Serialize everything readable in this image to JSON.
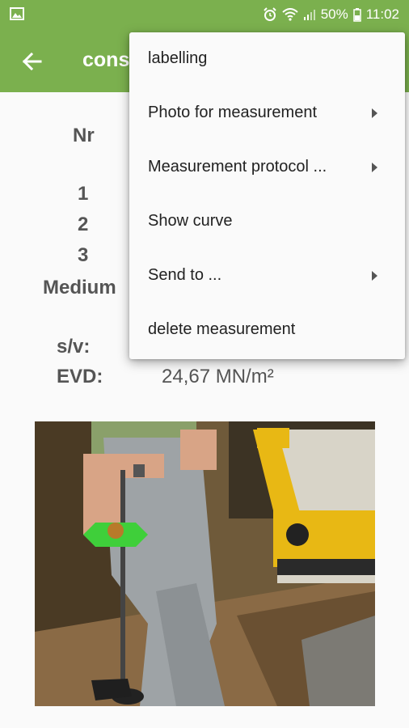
{
  "status_bar": {
    "battery": "50%",
    "time": "11:02",
    "icons": [
      "gallery-icon",
      "alarm-icon",
      "wifi-icon",
      "signal-icon",
      "battery-icon"
    ]
  },
  "app_bar": {
    "title": "cons",
    "back_icon": "arrow-left-icon"
  },
  "table": {
    "header": "Nr",
    "rows": [
      "1",
      "2",
      "3"
    ],
    "medium_label": "Medium"
  },
  "results": {
    "sv_label": "s/v:",
    "evd_label": "EVD:",
    "evd_value": "24,67 MN/m²"
  },
  "menu": {
    "items": [
      {
        "label": "labelling",
        "submenu": false
      },
      {
        "label": "Photo for measurement",
        "submenu": true
      },
      {
        "label": "Measurement protocol ...",
        "submenu": true
      },
      {
        "label": "Show curve",
        "submenu": false
      },
      {
        "label": "Send to ...",
        "submenu": true
      },
      {
        "label": "delete measurement",
        "submenu": false
      }
    ]
  },
  "colors": {
    "primary": "#7bb04e",
    "device_green": "#3fcf3a",
    "machine_yellow": "#e8b814"
  }
}
